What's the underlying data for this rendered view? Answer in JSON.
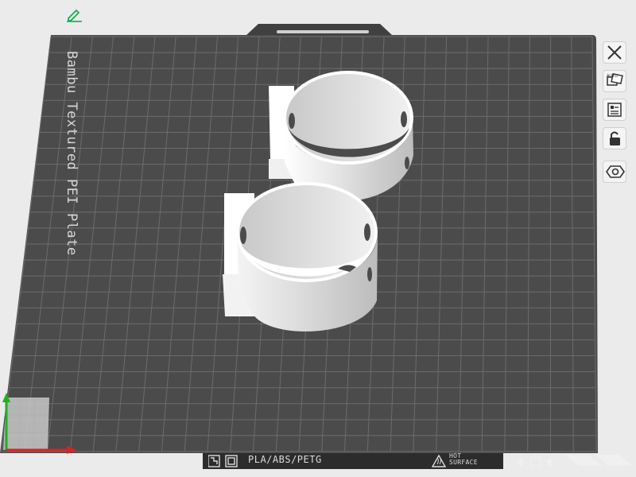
{
  "plate": {
    "name": "Bambu Textured PEI Plate",
    "filament_types": "PLA/ABS/PETG",
    "hot_surface_line1": "HOT",
    "hot_surface_line2": "SURFACE"
  },
  "toolbar": {
    "close_icon": "close-icon",
    "auto_arrange_icon": "auto-arrange-icon",
    "plate_layout_icon": "plate-layout-icon",
    "lock_icon": "lock-icon",
    "settings_icon": "settings-icon",
    "edit_icon": "pencil-icon"
  },
  "colors": {
    "accent": "#00ae42",
    "plate": "#4b4b4b",
    "grid": "#6c6c6c",
    "object": "#ffffff",
    "axis_x": "#e02020",
    "axis_y": "#20b020"
  }
}
